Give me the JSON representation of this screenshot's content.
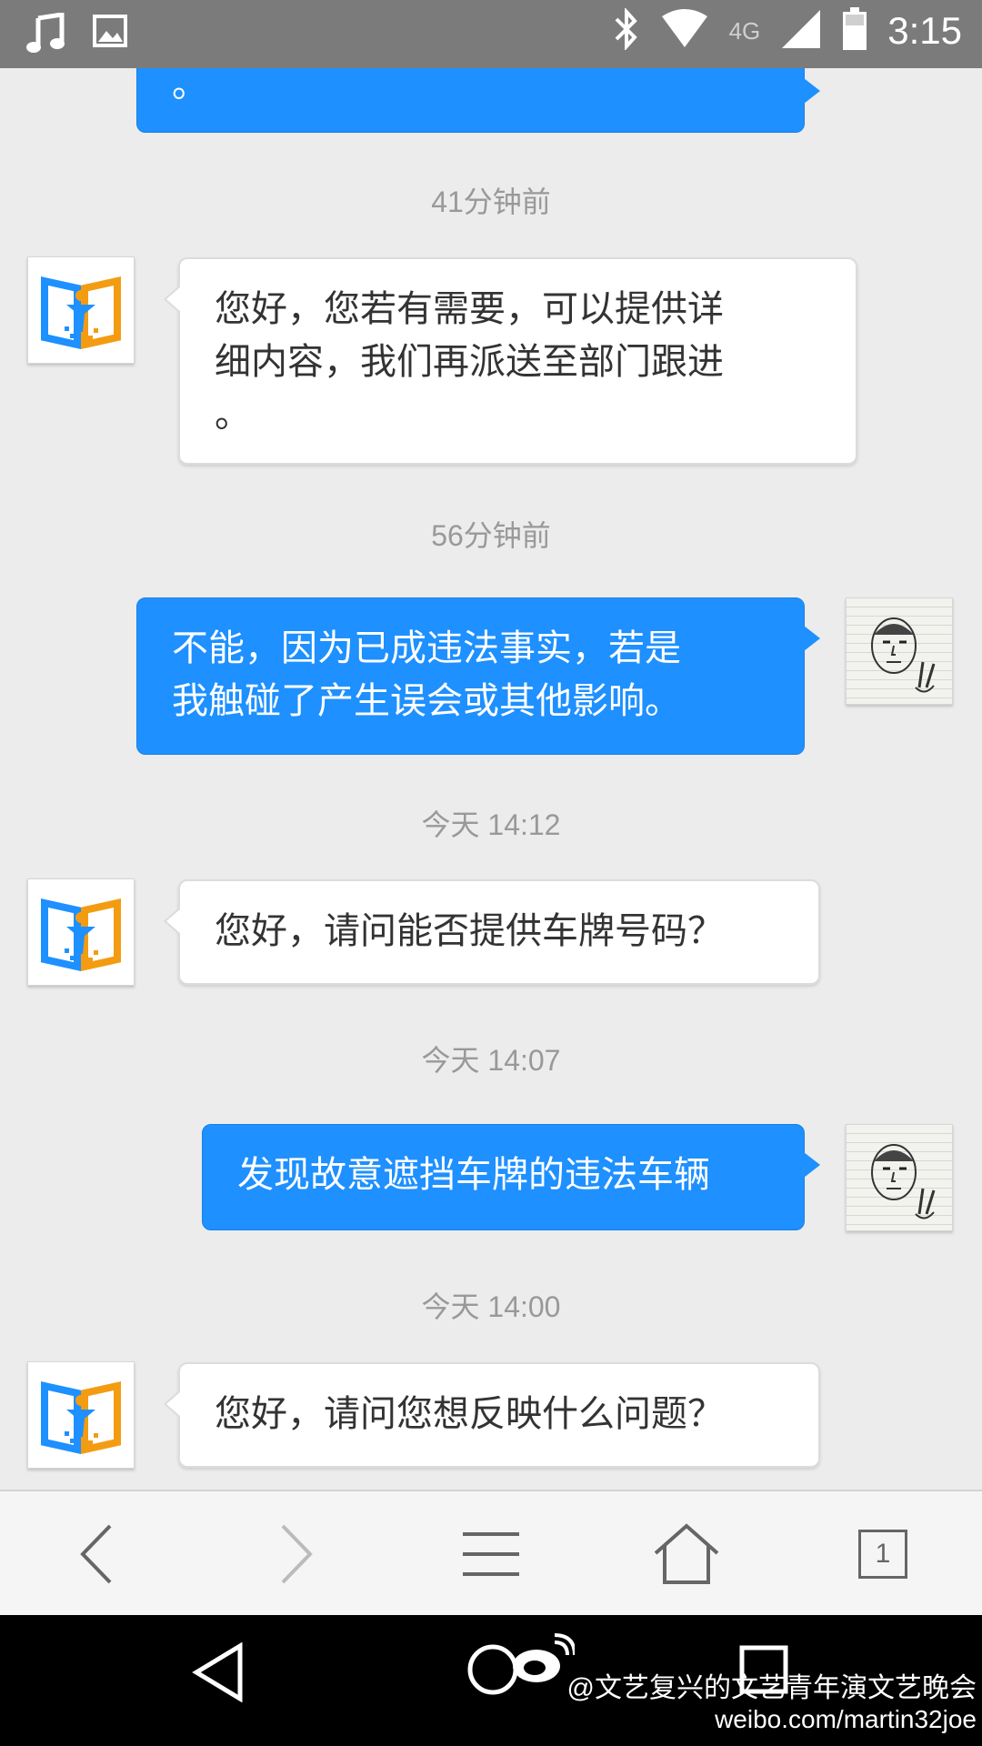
{
  "status_bar": {
    "time": "3:15",
    "network": "4G",
    "icons": [
      "music-icon",
      "image-icon",
      "bluetooth-icon",
      "wifi-icon",
      "signal-icon",
      "battery-icon"
    ]
  },
  "chat": {
    "partial_top_text": "。",
    "messages": [
      {
        "timestamp": "41分钟前",
        "side": "in",
        "lines": [
          "您好，您若有需要，可以提供详",
          "细内容，我们再派送至部门跟进",
          "。"
        ]
      },
      {
        "timestamp": "56分钟前",
        "side": "out",
        "lines": [
          "不能，因为已成违法事实，若是",
          "我触碰了产生误会或其他影响。"
        ]
      },
      {
        "timestamp": "今天 14:12",
        "side": "in",
        "lines": [
          "您好，请问能否提供车牌号码？"
        ]
      },
      {
        "timestamp": "今天 14:07",
        "side": "out",
        "lines": [
          "发现故意遮挡车牌的违法车辆"
        ]
      },
      {
        "timestamp": "今天 14:00",
        "side": "in",
        "lines": [
          "您好，请问您想反映什么问题？"
        ]
      }
    ]
  },
  "browser_nav": {
    "tab_count": "1",
    "buttons": [
      "back-icon",
      "forward-icon",
      "menu-icon",
      "home-icon",
      "tabs-icon"
    ]
  },
  "watermark": {
    "line1": "@文艺复兴的文艺青年演文艺晚会",
    "line2": "weibo.com/martin32joe"
  },
  "colors": {
    "outgoing_bubble": "#1e90ff",
    "incoming_bubble": "#ffffff",
    "background": "#ececec",
    "status_bar": "#7b7b7b"
  }
}
